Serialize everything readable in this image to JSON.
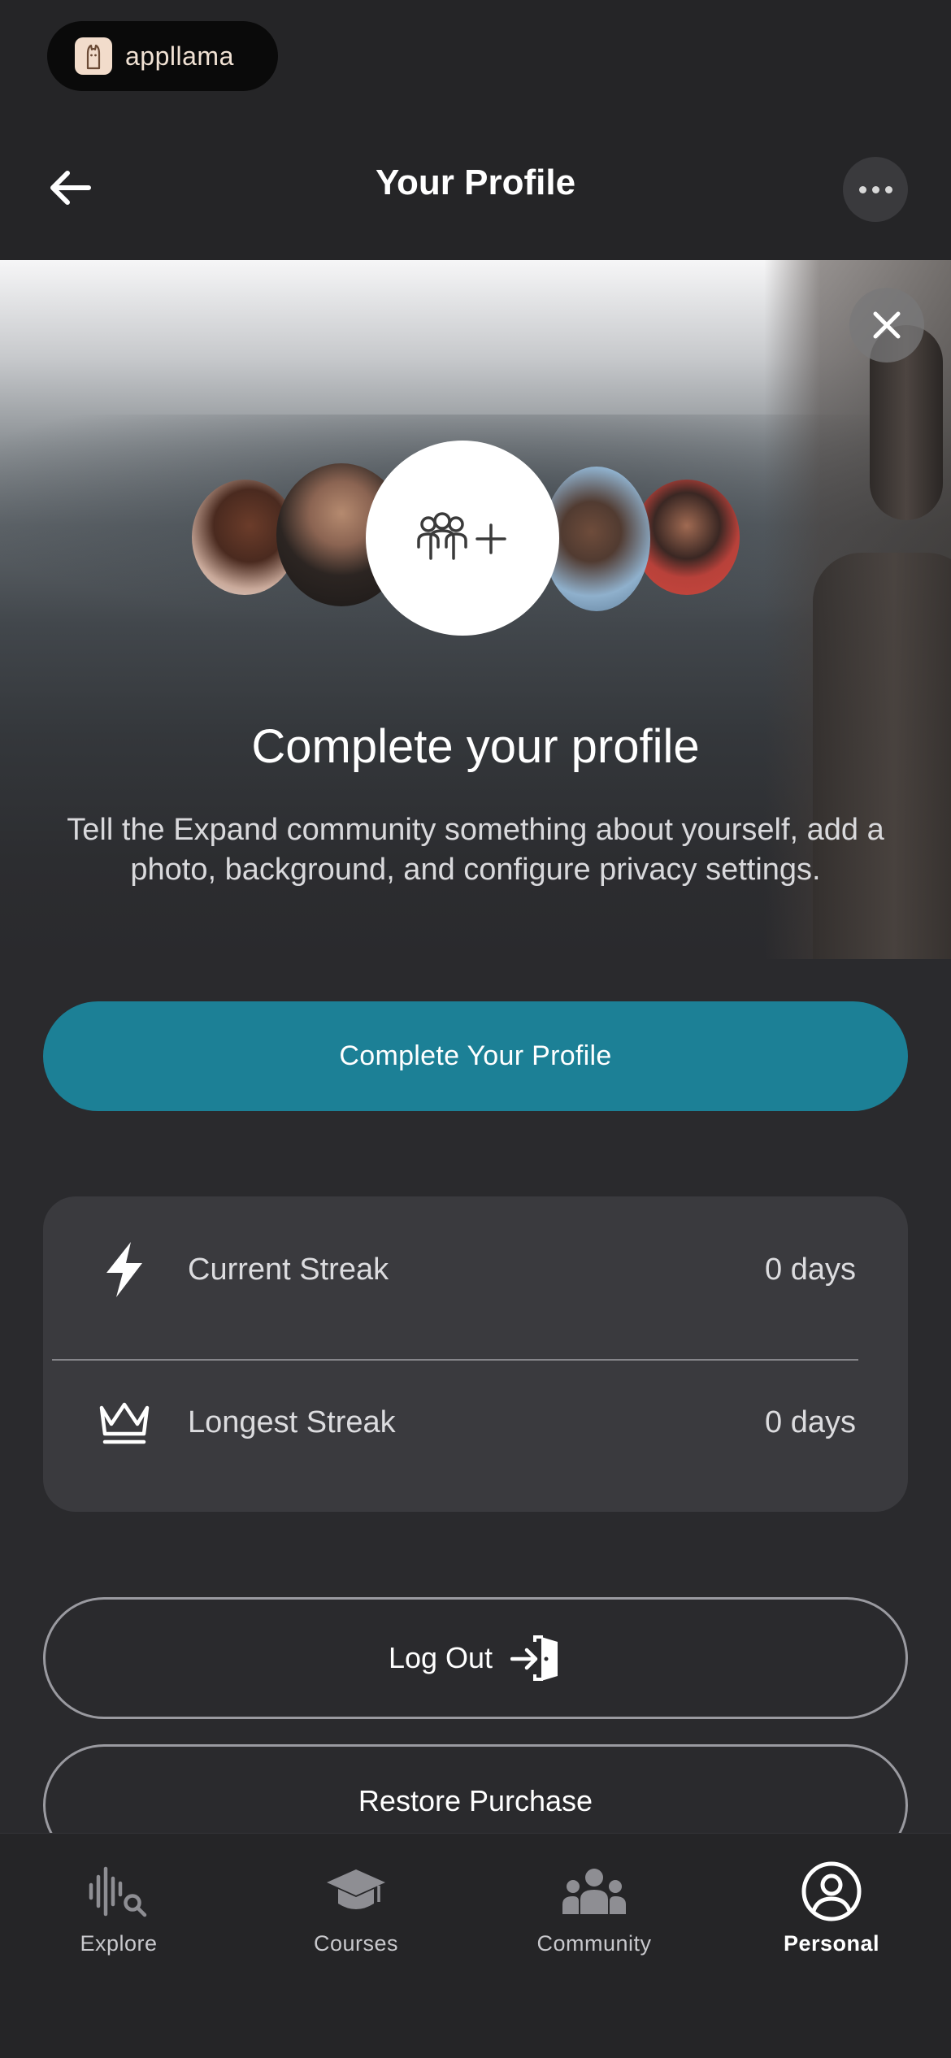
{
  "app_badge": {
    "name": "appllama",
    "logo_icon": "llama-icon"
  },
  "header": {
    "title": "Your Profile",
    "back_icon": "arrow-left-icon",
    "more_icon": "more-horizontal-icon"
  },
  "hero": {
    "close_icon": "close-icon",
    "group_icon": "group-add-icon",
    "title": "Complete your profile",
    "description": "Tell the Expand community something about yourself, add a photo, background, and configure privacy settings.",
    "cta_label": "Complete Your Profile"
  },
  "stats": [
    {
      "icon": "lightning-icon",
      "label": "Current Streak",
      "value": "0 days"
    },
    {
      "icon": "crown-icon",
      "label": "Longest Streak",
      "value": "0 days"
    }
  ],
  "buttons": {
    "logout": "Log Out",
    "restore": "Restore Purchase"
  },
  "tabs": [
    {
      "label": "Explore",
      "icon": "explore-icon",
      "active": false
    },
    {
      "label": "Courses",
      "icon": "graduation-cap-icon",
      "active": false
    },
    {
      "label": "Community",
      "icon": "community-icon",
      "active": false
    },
    {
      "label": "Personal",
      "icon": "user-circle-icon",
      "active": true
    }
  ],
  "colors": {
    "accent": "#1c8096",
    "background": "#2a2a2d",
    "card": "#3a3a3e"
  }
}
